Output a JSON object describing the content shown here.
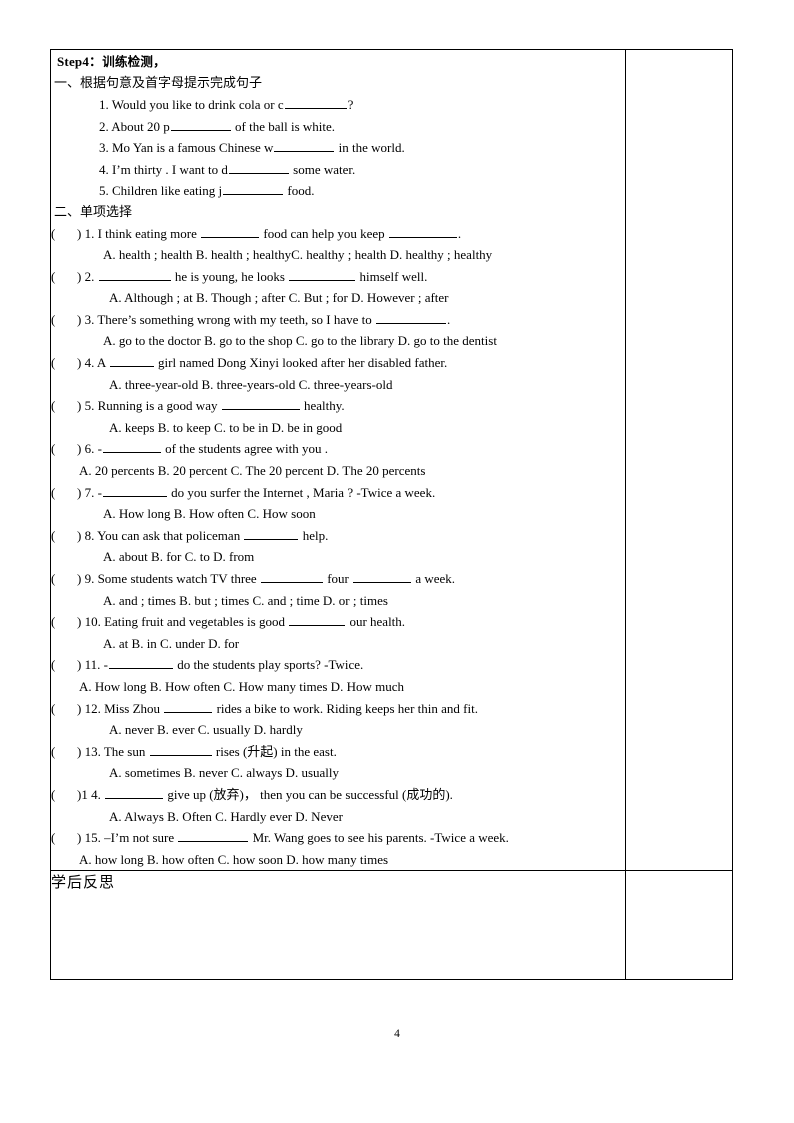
{
  "document": {
    "page_number": "4",
    "step_header": {
      "label": "Step4：",
      "chinese": "训练检测，"
    },
    "section_one": {
      "heading": "一、根据句意及首字母提示完成句子",
      "items": [
        {
          "pre": "1. Would you like to drink cola or c",
          "blank_width": "62",
          "post": "?"
        },
        {
          "pre": "2. About 20 p",
          "blank_width": "60",
          "post": " of the ball is white."
        },
        {
          "pre": "3. Mo Yan is a famous Chinese w",
          "blank_width": "60",
          "post": " in the world."
        },
        {
          "pre": "4. I’m thirty . I want to d",
          "blank_width": "60",
          "post": " some water."
        },
        {
          "pre": "5. Children like eating j",
          "blank_width": "60",
          "post": " food."
        }
      ]
    },
    "section_two": {
      "heading": "二、单项选择",
      "questions": [
        {
          "stem_pre": ") 1. I think eating more ",
          "blank_a": "58",
          "stem_mid": " food can help you keep ",
          "blank_b": "68",
          "stem_post": ".",
          "options": "A. health ; health    B. health ; healthyC. healthy ; health                D. healthy ; healthy",
          "options_indent": "ind-52"
        },
        {
          "stem_pre": ") 2. ",
          "blank_a": "72",
          "stem_mid": " he is young, he looks ",
          "blank_b": "66",
          "stem_post": " himself well.",
          "options": "A. Although ; at   B. Though ; after        C. But ; for        D. However ; after",
          "options_indent": "ind-58"
        },
        {
          "stem_pre": ") 3. There’s something wrong with my teeth, so I have to ",
          "blank_a": "70",
          "stem_mid": "",
          "blank_b": "0",
          "stem_post": ".",
          "options": "A. go to the doctor     B. go to the shop    C. go to the library     D. go to the dentist",
          "options_indent": "ind-52"
        },
        {
          "stem_pre": ") 4. A ",
          "blank_a": "44",
          "stem_mid": "",
          "blank_b": "0",
          "stem_post": " girl named Dong Xinyi looked after her disabled father.",
          "options": "A. three-year-old    B. three-years-old        C. three-years-old",
          "options_indent": "ind-58"
        },
        {
          "stem_pre": ") 5. Running is a good way ",
          "blank_a": "78",
          "stem_mid": "",
          "blank_b": "0",
          "stem_post": " healthy.",
          "options": "A. keeps        B. to keep      C. to be in       D. be in good",
          "options_indent": "ind-58"
        },
        {
          "stem_pre": ") 6. -",
          "blank_a": "58",
          "stem_mid": "",
          "blank_b": "0",
          "stem_post": " of the students agree with you .",
          "options": "A. 20 percents     B. 20 percent    C. The 20 percent    D. The 20 percents",
          "options_indent": "ind-28"
        },
        {
          "stem_pre": ") 7. -",
          "blank_a": "64",
          "stem_mid": "",
          "blank_b": "0",
          "stem_post": " do you surfer the Internet , Maria ?       -Twice a week.",
          "options": "A. How long            B. How often        C. How soon",
          "options_indent": "ind-52"
        },
        {
          "stem_pre": ") 8. You can ask that policeman ",
          "blank_a": "54",
          "stem_mid": "",
          "blank_b": "0",
          "stem_post": " help.",
          "options": "A. about        B. for           C. to         D. from",
          "options_indent": "ind-52"
        },
        {
          "stem_pre": ") 9. Some students watch TV three ",
          "blank_a": "62",
          "stem_mid": " four ",
          "blank_b": "58",
          "stem_post": " a week.",
          "options": "A. and ; times       B. but ; times     C. and ; time      D. or ; times",
          "options_indent": "ind-52"
        },
        {
          "stem_pre": ") 10. Eating fruit and vegetables is good ",
          "blank_a": "56",
          "stem_mid": "",
          "blank_b": "0",
          "stem_post": " our health.",
          "options": "A. at            B. in           C. under       D. for",
          "options_indent": "ind-52"
        },
        {
          "stem_pre": ") 11. -",
          "blank_a": "64",
          "stem_mid": "",
          "blank_b": "0",
          "stem_post": " do the students play sports?      -Twice.",
          "options": "A. How long       B. How often       C. How many times    D. How much",
          "options_indent": "ind-28"
        },
        {
          "stem_pre": ") 12. Miss Zhou ",
          "blank_a": "48",
          "stem_mid": "",
          "blank_b": "0",
          "stem_post": " rides a bike to work. Riding keeps her thin and fit.",
          "options": "A. never        B. ever            C. usually        D. hardly",
          "options_indent": "ind-58"
        },
        {
          "stem_pre": ") 13. The sun ",
          "blank_a": "62",
          "stem_mid": "",
          "blank_b": "0",
          "stem_post": " rises (升起) in the east.",
          "options": "A. sometimes      B. never          C. always     D. usually",
          "options_indent": "ind-58"
        },
        {
          "stem_pre": ")1 4. ",
          "blank_a": "58",
          "stem_mid": "",
          "blank_b": "0",
          "stem_post": " give up (放弃)，   then you can be successful (成功的).",
          "options": "A. Always        B. Often          C. Hardly ever      D. Never",
          "options_indent": "ind-58"
        },
        {
          "stem_pre": ") 15. –I’m not sure ",
          "blank_a": "70",
          "stem_mid": "",
          "blank_b": "0",
          "stem_post": " Mr. Wang goes to see his parents.     -Twice a week.",
          "options": "A. how long       B. how often      C. how soon       D. how many times",
          "options_indent": "ind-28"
        }
      ]
    },
    "reflection": {
      "label": "学后反思",
      "body": ""
    }
  }
}
